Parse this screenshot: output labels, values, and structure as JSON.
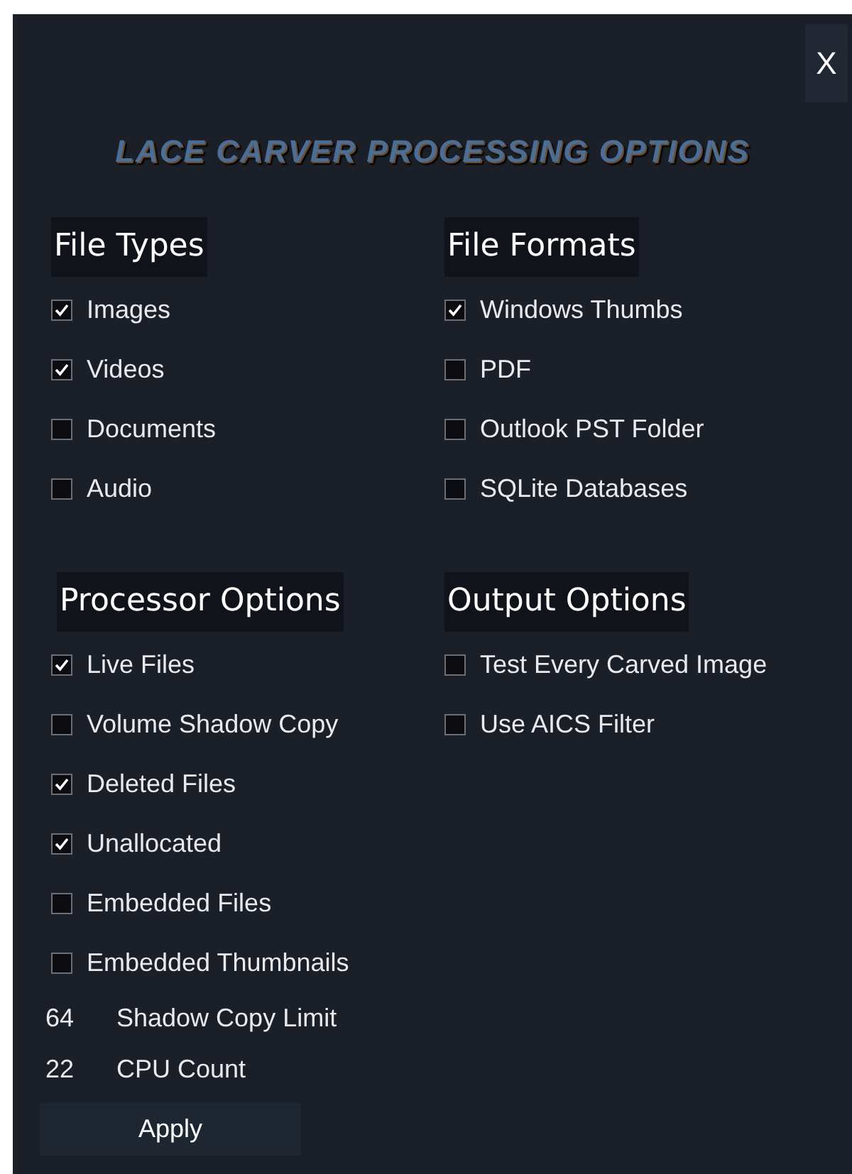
{
  "close_button": {
    "label": "X"
  },
  "title": "LACE CARVER PROCESSING OPTIONS",
  "groups": [
    {
      "title": "File Types",
      "items": [
        {
          "label": "Images",
          "checked": true
        },
        {
          "label": "Videos",
          "checked": true
        },
        {
          "label": "Documents",
          "checked": false
        },
        {
          "label": "Audio",
          "checked": false
        }
      ]
    },
    {
      "title": "File Formats",
      "items": [
        {
          "label": "Windows Thumbs",
          "checked": true
        },
        {
          "label": "PDF",
          "checked": false
        },
        {
          "label": "Outlook PST Folder",
          "checked": false
        },
        {
          "label": "SQLite Databases",
          "checked": false
        }
      ]
    },
    {
      "title": "Processor Options",
      "items": [
        {
          "label": "Live Files",
          "checked": true
        },
        {
          "label": "Volume Shadow Copy",
          "checked": false
        },
        {
          "label": "Deleted Files",
          "checked": true
        },
        {
          "label": "Unallocated",
          "checked": true
        },
        {
          "label": "Embedded Files",
          "checked": false
        },
        {
          "label": "Embedded Thumbnails",
          "checked": false
        }
      ],
      "fields": [
        {
          "value": "64",
          "label": "Shadow Copy Limit"
        },
        {
          "value": "22",
          "label": "CPU Count"
        }
      ]
    },
    {
      "title": "Output Options",
      "items": [
        {
          "label": "Test Every Carved Image",
          "checked": false
        },
        {
          "label": "Use AICS Filter",
          "checked": false
        }
      ]
    }
  ],
  "apply_button": {
    "label": "Apply"
  }
}
